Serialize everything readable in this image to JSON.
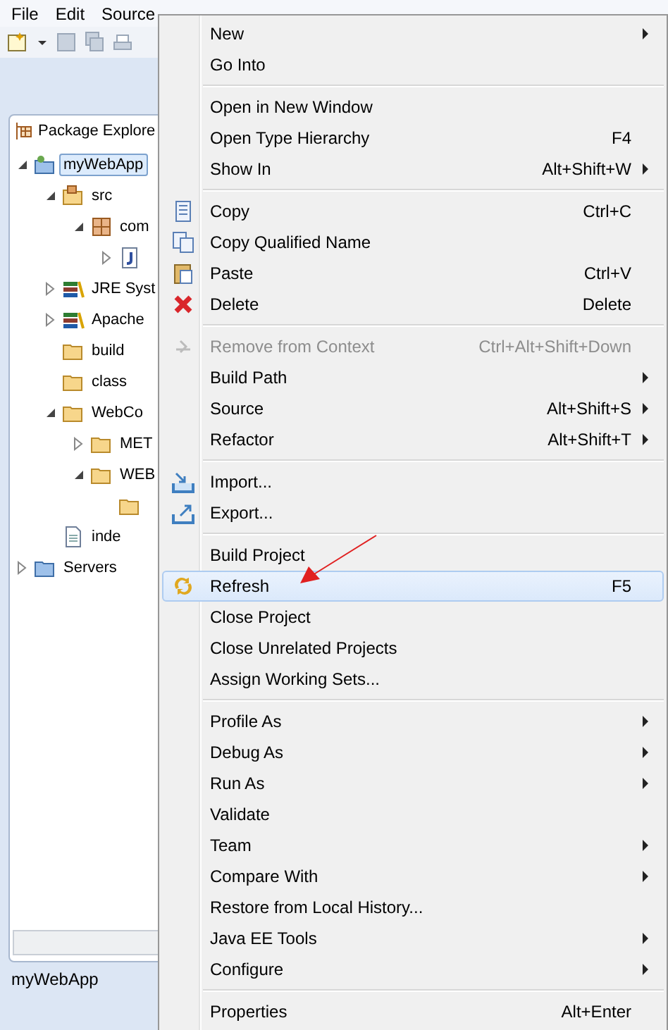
{
  "menu_bar": [
    "File",
    "Edit",
    "Source"
  ],
  "view_tab": {
    "title": "Package Explore"
  },
  "tree": [
    {
      "label": "myWebApp",
      "kind": "project",
      "expanded": true,
      "selected": true,
      "children": [
        {
          "label": "src",
          "kind": "source-folder",
          "expanded": true,
          "children": [
            {
              "label": "com",
              "kind": "package",
              "expanded": true,
              "children": [
                {
                  "kind": "java-file",
                  "expanded": false
                }
              ]
            }
          ]
        },
        {
          "label": "JRE Syst",
          "kind": "library",
          "expanded": false
        },
        {
          "label": "Apache",
          "kind": "library",
          "expanded": false
        },
        {
          "label": "build",
          "kind": "folder"
        },
        {
          "label": "class",
          "kind": "folder"
        },
        {
          "label": "WebCo",
          "kind": "folder",
          "expanded": true,
          "children": [
            {
              "label": "MET",
              "kind": "folder",
              "expanded": false
            },
            {
              "label": "WEB",
              "kind": "folder",
              "expanded": true,
              "children": [
                {
                  "kind": "folder"
                }
              ]
            }
          ]
        },
        {
          "label": "inde",
          "kind": "file"
        }
      ]
    },
    {
      "label": "Servers",
      "kind": "servers",
      "expanded": false
    }
  ],
  "status_bar": "myWebApp",
  "context_menu": [
    {
      "kind": "item",
      "label": "New",
      "submenu": true
    },
    {
      "kind": "item",
      "label": "Go Into"
    },
    {
      "kind": "separator"
    },
    {
      "kind": "item",
      "label": "Open in New Window"
    },
    {
      "kind": "item",
      "label": "Open Type Hierarchy",
      "shortcut": "F4"
    },
    {
      "kind": "item",
      "label": "Show In",
      "shortcut": "Alt+Shift+W",
      "submenu": true
    },
    {
      "kind": "separator"
    },
    {
      "kind": "copy",
      "label": "Copy",
      "shortcut": "Ctrl+C"
    },
    {
      "kind": "copy-name",
      "label": "Copy Qualified Name"
    },
    {
      "kind": "paste",
      "label": "Paste",
      "shortcut": "Ctrl+V"
    },
    {
      "kind": "delete",
      "label": "Delete",
      "shortcut": "Delete"
    },
    {
      "kind": "separator"
    },
    {
      "kind": "remove",
      "label": "Remove from Context",
      "shortcut": "Ctrl+Alt+Shift+Down",
      "disabled": true
    },
    {
      "kind": "item",
      "label": "Build Path",
      "submenu": true
    },
    {
      "kind": "item",
      "label": "Source",
      "shortcut": "Alt+Shift+S",
      "submenu": true
    },
    {
      "kind": "item",
      "label": "Refactor",
      "shortcut": "Alt+Shift+T",
      "submenu": true
    },
    {
      "kind": "separator"
    },
    {
      "kind": "import",
      "label": "Import..."
    },
    {
      "kind": "export",
      "label": "Export..."
    },
    {
      "kind": "separator"
    },
    {
      "kind": "item",
      "label": "Build Project"
    },
    {
      "kind": "refresh",
      "label": "Refresh",
      "shortcut": "F5",
      "selected": true
    },
    {
      "kind": "item",
      "label": "Close Project"
    },
    {
      "kind": "item",
      "label": "Close Unrelated Projects"
    },
    {
      "kind": "item",
      "label": "Assign Working Sets..."
    },
    {
      "kind": "separator"
    },
    {
      "kind": "item",
      "label": "Profile As",
      "submenu": true
    },
    {
      "kind": "item",
      "label": "Debug As",
      "submenu": true
    },
    {
      "kind": "item",
      "label": "Run As",
      "submenu": true
    },
    {
      "kind": "item",
      "label": "Validate"
    },
    {
      "kind": "item",
      "label": "Team",
      "submenu": true
    },
    {
      "kind": "item",
      "label": "Compare With",
      "submenu": true
    },
    {
      "kind": "item",
      "label": "Restore from Local History..."
    },
    {
      "kind": "item",
      "label": "Java EE Tools",
      "submenu": true
    },
    {
      "kind": "item",
      "label": "Configure",
      "submenu": true
    },
    {
      "kind": "separator"
    },
    {
      "kind": "item",
      "label": "Properties",
      "shortcut": "Alt+Enter"
    }
  ]
}
